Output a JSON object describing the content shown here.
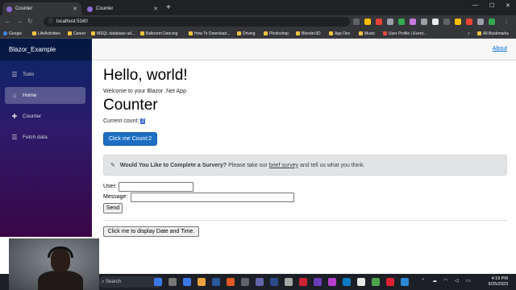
{
  "browser": {
    "tabs": [
      {
        "label": "Counter",
        "active": true
      },
      {
        "label": "Counter",
        "active": false
      }
    ],
    "new_tab": "+",
    "window_controls": {
      "minimize": "—",
      "maximize": "☐",
      "close": "✕"
    },
    "url": "localhost:5160",
    "bookmarks": [
      "Google",
      "LifeActivities",
      "Career",
      "MSQL database ad...",
      "Ballroom Dancing",
      "How To Download...",
      "Driving",
      "Photoshop",
      "Blender3D",
      "App Dev",
      "Music",
      "User Profile | Event..."
    ],
    "more_bookmarks": "»",
    "all_bookmarks": "All Bookmarks",
    "extension_colors": [
      "#5f6368",
      "#fbbc04",
      "#ea4335",
      "#9aa0a6",
      "#34a853",
      "#c47bdc",
      "#9aa0a6",
      "#e8eaed"
    ]
  },
  "app": {
    "brand": "Blazor_Example",
    "nav": [
      {
        "label": "Todo",
        "icon": "list-icon",
        "active": false
      },
      {
        "label": "Home",
        "icon": "home-icon",
        "active": true
      },
      {
        "label": "Counter",
        "icon": "plus-icon",
        "active": false
      },
      {
        "label": "Fetch data",
        "icon": "list-icon",
        "active": false
      }
    ],
    "about_link": "About",
    "main": {
      "heading": "Hello, world!",
      "welcome": "Welcome to your Blazor .Net App",
      "counter_heading": "Counter",
      "current_count_label": "Current count:",
      "current_count_value": "2",
      "count_button": "Click me Count:2",
      "survey": {
        "icon": "pencil-icon",
        "title": "Would You Like to Complete a Survery?",
        "before_link": "Please take our",
        "link": "brief survey",
        "after_link": "and tell us what you think."
      },
      "user_label": "User:",
      "message_label": "Message:",
      "user_value": "",
      "message_value": "",
      "send_button": "Send",
      "datetime_button": "Click me to display Date and Time."
    }
  },
  "taskbar": {
    "search_label": "Search",
    "clock_time": "4:19 PM",
    "clock_date": "9/25/2023",
    "app_icon_colors": [
      "#3b78e7",
      "#777",
      "#3b78e7",
      "#e8a33d",
      "#2b579a",
      "#e25822",
      "#5f6368",
      "#6264a7",
      "#2a4a8a",
      "#a6a6a6",
      "#c23",
      "#6a3db8",
      "#b73fcf",
      "#0e7ac4",
      "#e8e8e8",
      "#4ea34b",
      "#d23",
      "#2b88d8"
    ]
  }
}
